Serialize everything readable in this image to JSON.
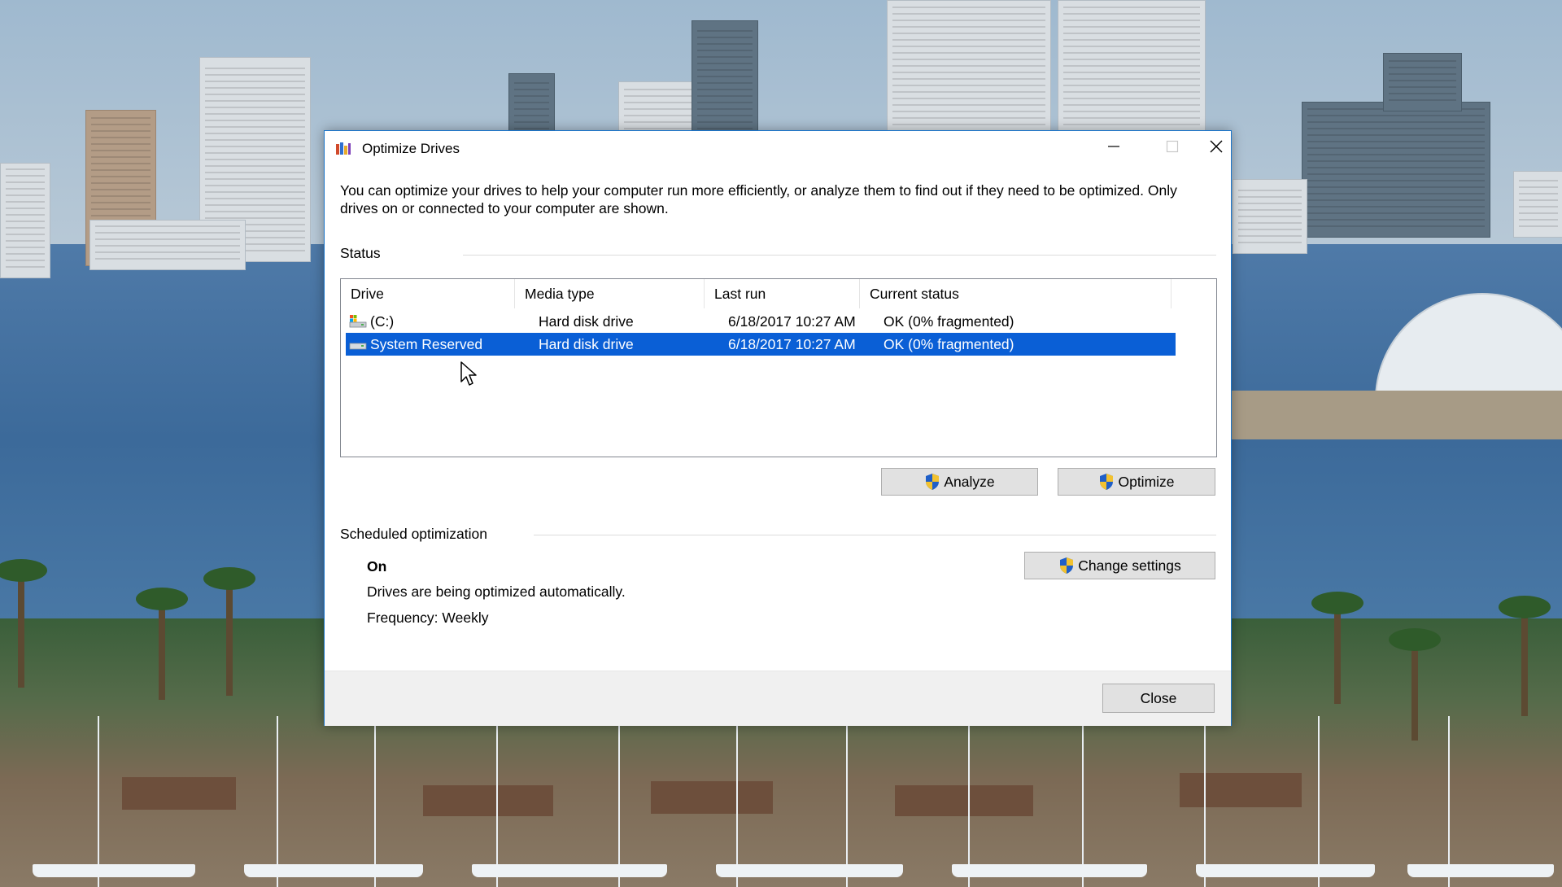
{
  "window": {
    "title": "Optimize Drives",
    "intro": "You can optimize your drives to help your computer run more efficiently, or analyze them to find out if they need to be optimized. Only drives on or connected to your computer are shown."
  },
  "status": {
    "group_title": "Status",
    "columns": [
      "Drive",
      "Media type",
      "Last run",
      "Current status"
    ],
    "rows": [
      {
        "drive": "(C:)",
        "media_type": "Hard disk drive",
        "last_run": "6/18/2017 10:27 AM",
        "current_status": "OK (0% fragmented)",
        "icon": "os-drive-icon",
        "selected": false
      },
      {
        "drive": "System Reserved",
        "media_type": "Hard disk drive",
        "last_run": "6/18/2017 10:27 AM",
        "current_status": "OK (0% fragmented)",
        "icon": "drive-icon",
        "selected": true
      }
    ],
    "analyze_label": "Analyze",
    "optimize_label": "Optimize"
  },
  "scheduled": {
    "group_title": "Scheduled optimization",
    "state": "On",
    "description": "Drives are being optimized automatically.",
    "frequency": "Frequency: Weekly",
    "change_settings_label": "Change settings"
  },
  "footer": {
    "close_label": "Close"
  },
  "colors": {
    "selection": "#0a5fd6",
    "window_border": "#1a74c9",
    "button_face": "#e1e1e1"
  }
}
